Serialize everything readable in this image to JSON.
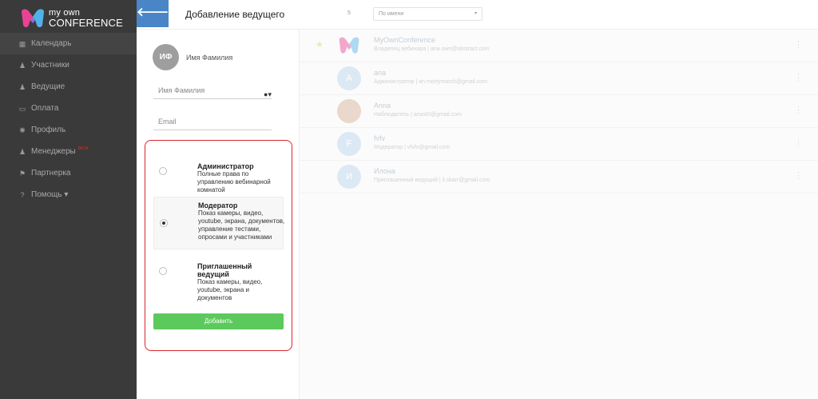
{
  "brand": {
    "line1": "my own",
    "line2": "CONFERENCE",
    "colors": {
      "pink": "#e84393",
      "blue": "#4fb3e8",
      "purple": "#8e6fd8"
    }
  },
  "sidebar": {
    "items": [
      {
        "label": "Календарь",
        "icon": "calendar-icon",
        "active": true
      },
      {
        "label": "Участники",
        "icon": "users-icon"
      },
      {
        "label": "Ведущие",
        "icon": "presenters-icon"
      },
      {
        "label": "Оплата",
        "icon": "wallet-icon"
      },
      {
        "label": "Профиль",
        "icon": "gear-icon"
      },
      {
        "label": "Менеджеры",
        "icon": "managers-icon",
        "badge": "BETA"
      },
      {
        "label": "Партнерка",
        "icon": "partner-icon"
      },
      {
        "label": "Помощь ▾",
        "icon": "help-icon"
      }
    ]
  },
  "header": {
    "back_icon": "arrow-left-icon",
    "title": "Добавление ведущего",
    "count": "5",
    "sort": {
      "value": "По имени"
    }
  },
  "form": {
    "avatar_initials": "ИФ",
    "avatar_name": "Имя Фамилия",
    "name_placeholder": "Имя Фамилия",
    "email_placeholder": "Email",
    "roles": [
      {
        "title": "Администратор",
        "desc": "Полные права по управлению вебинарной комнатой",
        "selected": false
      },
      {
        "title": "Модератор",
        "desc": "Показ камеры, видео, youtube, экрана, документов, управление тестами, опросами и участниками",
        "selected": true
      },
      {
        "title": "Приглашенный ведущий",
        "desc": "Показ камеры, видео, youtube, экрана и документов",
        "selected": false
      }
    ],
    "submit_label": "Добавить",
    "accent_color": "#5cc95c",
    "highlight_color": "#d9262f"
  },
  "list": {
    "rows": [
      {
        "name": "MyOwnConference",
        "meta": "Владелец вебинара | ana.own@abstract.com",
        "avatar": "",
        "starred": true
      },
      {
        "name": "ana",
        "meta": "Администратор | an.mortymarch@gmail.com",
        "avatar": "A",
        "starred": false
      },
      {
        "name": "Anna",
        "meta": "Наблюдатель | anast0@gmail.com",
        "avatar": "",
        "starred": false
      },
      {
        "name": "fvfv",
        "meta": "Модератор | vfvfv@gmail.com",
        "avatar": "F",
        "starred": false
      },
      {
        "name": "Илона",
        "meta": "Приглашенный ведущий | il.skarr@gmail.com",
        "avatar": "И",
        "starred": false
      }
    ]
  }
}
